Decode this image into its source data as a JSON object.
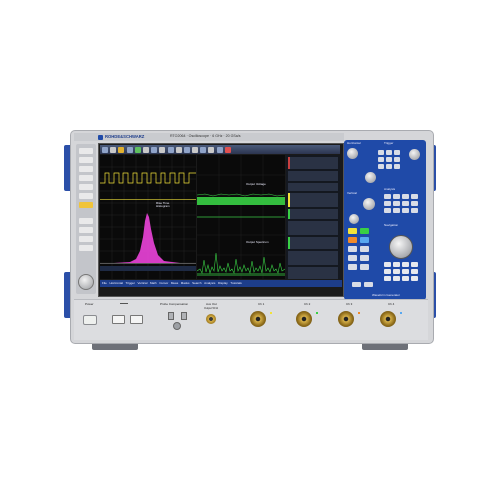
{
  "brand": "ROHDE&SCHWARZ",
  "model_line": "RTO2064 · Oscilloscope · 6 GHz · 20 GSa/s",
  "screen": {
    "trace_labels": {
      "rise_time_histogram": "Rise Time Histogram",
      "output_voltage": "Output Voltage",
      "output_spectrum": "Output Spectrum"
    },
    "menu_items": [
      "File",
      "Horizontal",
      "Trigger",
      "Vertical",
      "Math",
      "Cursor",
      "Meas",
      "Masks",
      "Search",
      "Analysis",
      "Display",
      "Tutorials"
    ]
  },
  "front_panel": {
    "power_label": "Power",
    "probe_compensation_label": "Probe Compensation",
    "aux_out_label": "Aux Out",
    "aux_out_sub": "Output 50 Ω",
    "channels": [
      "Ch 1",
      "Ch 2",
      "Ch 3",
      "Ch 4"
    ]
  },
  "control_panel": {
    "horizontal": "Horizontal",
    "trigger": "Trigger",
    "vertical": "Vertical",
    "analysis": "Analysis",
    "navigation": "Navigation",
    "waveform_generator": "Waveform Generator"
  },
  "colors": {
    "screen_bg": "#0a0a0a",
    "trace_yellow": "#f2e23a",
    "trace_green": "#39d045",
    "histogram_magenta": "#e040d0",
    "menu_bar": "#1d3d8a",
    "panel_blue": "#1f4aa8",
    "bezel": "#c4c6ca"
  }
}
